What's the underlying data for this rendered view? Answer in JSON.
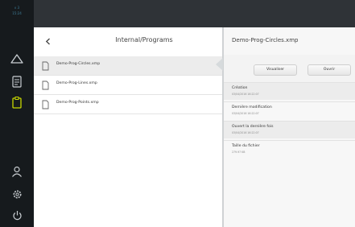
{
  "status_bar": {
    "line1": "ʌ 3",
    "line2": "15:24"
  },
  "rail": {
    "icons": [
      "warning-triangle-icon",
      "document-icon",
      "clipboard-icon",
      "user-icon",
      "settings-icon",
      "power-icon"
    ]
  },
  "file_browser": {
    "path": "Internal/Programs",
    "back_icon": "chevron-left-icon",
    "files": [
      {
        "name": "Demo-Prog-Circles.xmp",
        "selected": true
      },
      {
        "name": "Demo-Prog-Lines.xmp",
        "selected": false
      },
      {
        "name": "Demo-Prog-Points.xmp",
        "selected": false
      }
    ]
  },
  "details": {
    "title": "Demo-Prog-Circles.xmp",
    "buttons": {
      "view": "Visualiser",
      "open": "Ouvrir"
    },
    "fields": [
      {
        "label": "Création",
        "value": "03/04/2016 16:22:07"
      },
      {
        "label": "Dernière modification",
        "value": "03/04/2016 16:22:07"
      },
      {
        "label": "Ouvert la dernière fois",
        "value": "03/04/2016 16:22:07"
      },
      {
        "label": "Taille du fichier",
        "value": "279.97 KB"
      }
    ]
  },
  "colors": {
    "rail_bg": "#161a1d",
    "topbar_bg": "#2f3337",
    "accent": "#3f7f9a"
  }
}
